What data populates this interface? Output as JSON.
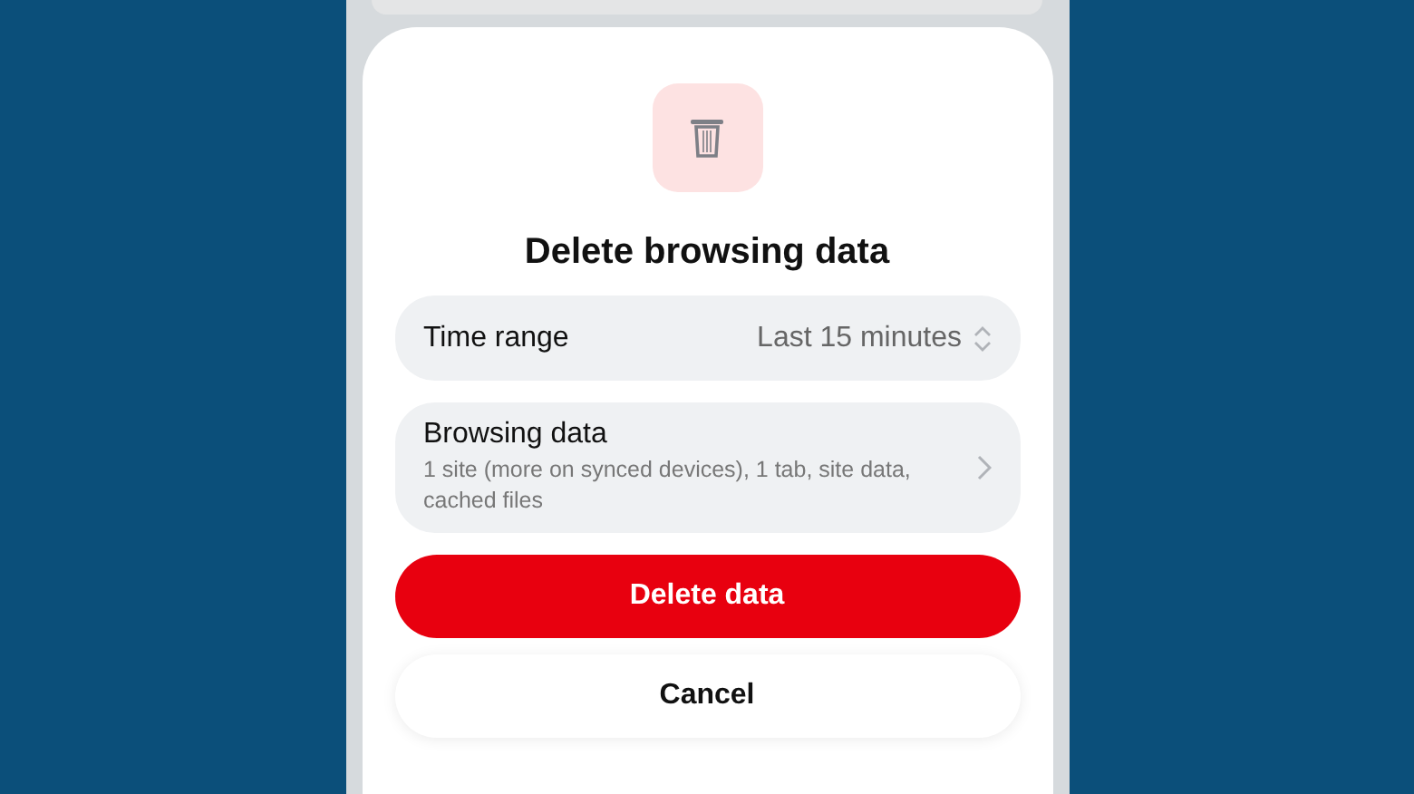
{
  "dialog": {
    "title": "Delete browsing data",
    "rows": [
      {
        "kind": "picker",
        "label": "Time range",
        "value": "Last 15 minutes"
      },
      {
        "kind": "link",
        "label": "Browsing data",
        "detail": "1 site (more on synced devices), 1 tab, site data, cached files"
      }
    ],
    "buttons": [
      {
        "kind": "destructive",
        "label": "Delete data"
      },
      {
        "kind": "plain",
        "label": "Cancel"
      }
    ]
  }
}
